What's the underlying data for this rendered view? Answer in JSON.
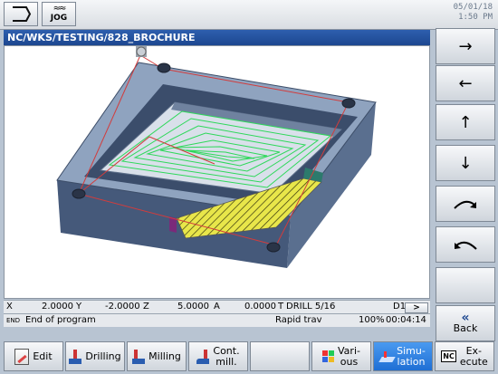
{
  "topbar": {
    "mode_label": "JOG",
    "mode_glyph": "≈≈",
    "date": "05/01/18",
    "time": "1:50 PM"
  },
  "path": "NC/WKS/TESTING/828_BROCHURE",
  "status": {
    "x_label": "X",
    "x_value": "2.0000",
    "y_label": "Y",
    "y_value": "-2.0000",
    "z_label": "Z",
    "z_value": "5.0000",
    "a_label": "A",
    "a_value": "0.0000",
    "tool_label": "T",
    "tool_value": "DRILL 5/16",
    "d_value": "D1",
    "end_label": "END",
    "program_msg": "End of program",
    "feed_mode": "Rapid trav",
    "percent": "100%",
    "elapsed": "00:04:14"
  },
  "scroll_arrow": ">",
  "vertical_softkeys": {
    "right_arrow": "→",
    "left_arrow": "←",
    "up_arrow": "↑",
    "down_arrow": "↓",
    "rotate_cw": "⤸",
    "rotate_ccw": "⤹",
    "back_glyph": "«",
    "back_label": "Back"
  },
  "bottom_softkeys": {
    "edit": "Edit",
    "drilling": "Drilling",
    "milling": "Milling",
    "cont_mill_1": "Cont.",
    "cont_mill_2": "mill.",
    "various_1": "Vari-",
    "various_2": "ous",
    "simulation_1": "Simu-",
    "simulation_2": "lation",
    "execute_1": "Ex-",
    "execute_2": "ecute",
    "nc_icon_text": "NC"
  },
  "colors": {
    "title_bar": "#1d4790",
    "part_top": "#8aa0bc",
    "part_side": "#50678a",
    "pocket_floor": "#dfe5ee",
    "toolpath": "#2ed85a",
    "rapid_path": "#d23c3c",
    "ledge": "#e8e64a",
    "selected_softkey": "#2b7de0"
  }
}
